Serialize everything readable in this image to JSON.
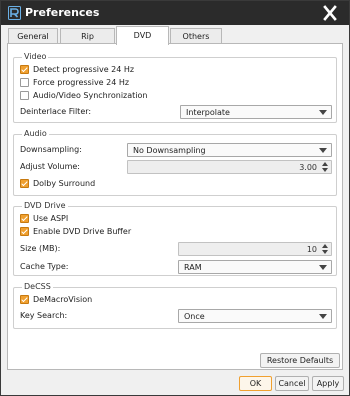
{
  "window": {
    "title": "Preferences"
  },
  "tabs": [
    {
      "label": "General",
      "active": false
    },
    {
      "label": "Rip",
      "active": false
    },
    {
      "label": "DVD",
      "active": true
    },
    {
      "label": "Others",
      "active": false
    }
  ],
  "video": {
    "title": "Video",
    "detect_progressive": {
      "label": "Detect progressive 24 Hz",
      "checked": true
    },
    "force_progressive": {
      "label": "Force progressive 24 Hz",
      "checked": false
    },
    "av_sync": {
      "label": "Audio/Video Synchronization",
      "checked": false
    },
    "deinterlace_label": "Deinterlace Filter:",
    "deinterlace_value": "Interpolate"
  },
  "audio": {
    "title": "Audio",
    "downsampling_label": "Downsampling:",
    "downsampling_value": "No Downsampling",
    "volume_label": "Adjust Volume:",
    "volume_value": "3.00",
    "dolby": {
      "label": "Dolby Surround",
      "checked": true
    }
  },
  "dvd_drive": {
    "title": "DVD Drive",
    "use_aspi": {
      "label": "Use ASPI",
      "checked": true
    },
    "enable_buffer": {
      "label": "Enable DVD Drive Buffer",
      "checked": true
    },
    "size_label": "Size (MB):",
    "size_value": "10",
    "cache_label": "Cache Type:",
    "cache_value": "RAM"
  },
  "decss": {
    "title": "DeCSS",
    "demacrovision": {
      "label": "DeMacroVision",
      "checked": true
    },
    "key_search_label": "Key Search:",
    "key_search_value": "Once"
  },
  "buttons": {
    "restore": "Restore Defaults",
    "ok": "OK",
    "cancel": "Cancel",
    "apply": "Apply"
  },
  "colors": {
    "accent": "#f0a030",
    "titlebar": "#2b2b2b"
  },
  "icons": {
    "app": "app-logo-icon",
    "close": "close-icon",
    "dropdown": "chevron-down-icon",
    "spin": "spin-arrows-icon"
  }
}
